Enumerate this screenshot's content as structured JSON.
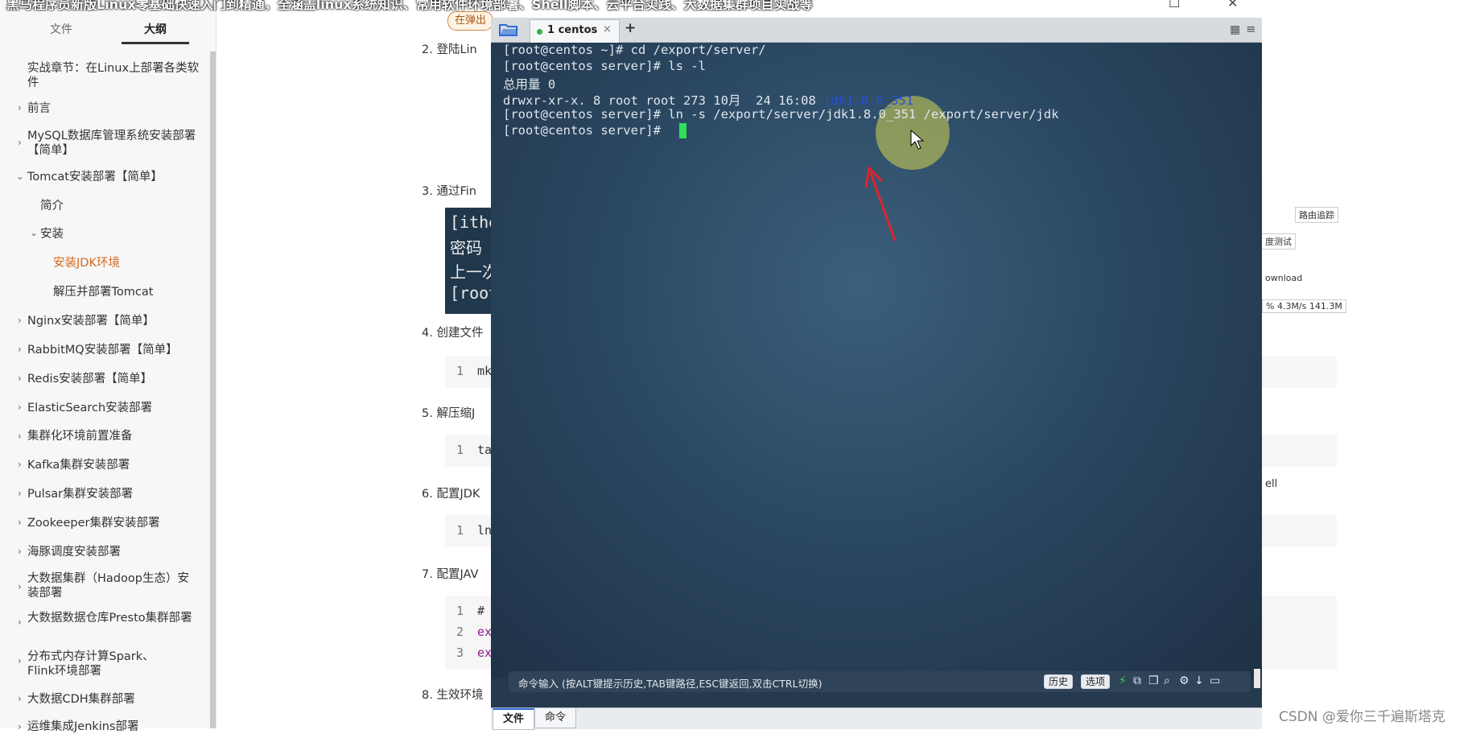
{
  "video_title": "黑马程序员新版Linux零基础快速入门到精通，全涵盖linux系统知识、常用软件环境部署、Shell脚本、云平台实践、大数据集群项目实战等",
  "sidebar": {
    "tabs": [
      "文件",
      "大纲"
    ],
    "items": [
      "实战章节：在Linux上部署各类软件",
      "前言",
      "MySQL数据库管理系统安装部署【简单】",
      "Tomcat安装部署【简单】",
      "简介",
      "安装",
      "安装JDK环境",
      "解压并部署Tomcat",
      "Nginx安装部署【简单】",
      "RabbitMQ安装部署【简单】",
      "Redis安装部署【简单】",
      "ElasticSearch安装部署",
      "集群化环境前置准备",
      "Kafka集群安装部署",
      "Pulsar集群安装部署",
      "Zookeeper集群安装部署",
      "海豚调度安装部署",
      "大数据集群（Hadoop生态）安装部署",
      "大数据数据仓库Presto集群部署",
      "分布式内存计算Spark、Flink环境部署",
      "大数据CDH集群部署",
      "运维集成Jenkins部署"
    ]
  },
  "doc": {
    "tip": "在弹出",
    "steps": [
      "2. 登陆Lin",
      "3. 通过Fin",
      "4. 创建文件",
      "5. 解压缩J",
      "6. 配置JDK",
      "7. 配置JAV",
      "8. 生效环境"
    ],
    "dark_lines": [
      "[ithe",
      "密码",
      "上一次",
      "[root"
    ],
    "code": [
      {
        "ln": "1",
        "text": "mk"
      },
      {
        "ln": "1",
        "text": "ta"
      },
      {
        "ln": "1",
        "text": "ln"
      },
      {
        "ln": "1",
        "text": "#"
      },
      {
        "ln": "2",
        "text": "ex"
      },
      {
        "ln": "3",
        "text": "ex"
      }
    ],
    "right_ui": [
      "路由追踪",
      "度测试",
      "ownload",
      "% 4.3M/s 141.3M",
      "ell"
    ]
  },
  "terminal": {
    "tab_label": "1 centos",
    "lines": [
      "[root@centos ~]# cd /export/server/",
      "[root@centos server]# ls -l",
      "总用量 0",
      "drwxr-xr-x. 8 root root 273 10月  24 16:08 ",
      "[root@centos server]# ln -s /export/server/jdk1.8.0_351 /export/server/jdk",
      "[root@centos server]# "
    ],
    "highlight_dir": "jdk1.8.0_351",
    "cmd_hint": "命令输入 (按ALT键提示历史,TAB键路径,ESC键返回,双击CTRL切换)",
    "cmd_buttons": [
      "历史",
      "选项"
    ],
    "bottom_tabs": [
      "文件",
      "命令"
    ]
  },
  "watermark": "CSDN @爱你三千遍斯塔克",
  "colors": {
    "accent_orange": "#d2691e",
    "terminal_bg": "#25394f",
    "cursor": "#2ee05a",
    "ls_dir": "#2a4fd6"
  }
}
